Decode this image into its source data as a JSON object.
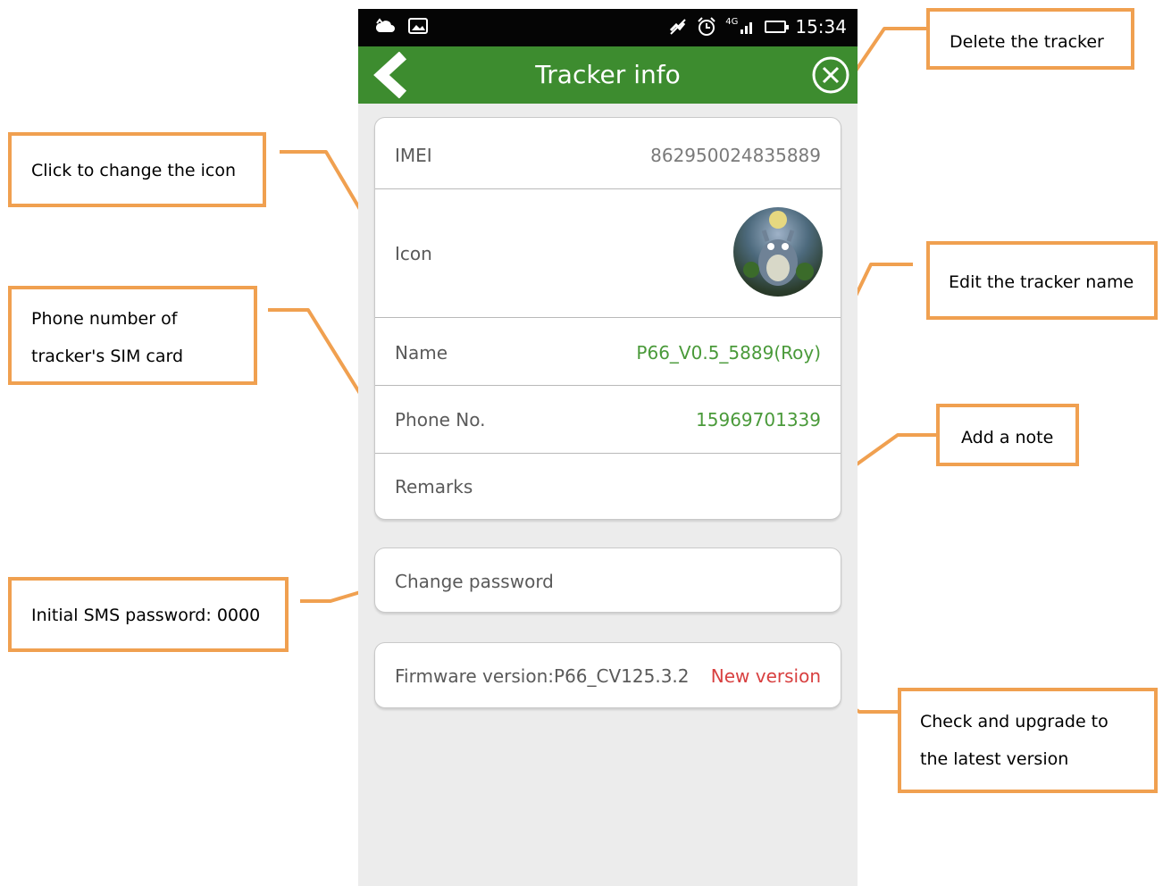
{
  "status_bar": {
    "icons_left": [
      "cloud-icon",
      "image-icon"
    ],
    "icons_right": [
      "mute-icon",
      "alarm-icon",
      "signal-icon",
      "battery-icon"
    ],
    "network": "4G",
    "time": "15:34"
  },
  "app_bar": {
    "title": "Tracker info",
    "back_icon": "chevron-left-icon",
    "delete_icon": "close-circle-icon"
  },
  "info": {
    "imei_label": "IMEI",
    "imei_value": "862950024835889",
    "icon_label": "Icon",
    "name_label": "Name",
    "name_value": "P66_V0.5_5889(Roy)",
    "phone_label": "Phone No.",
    "phone_value": "15969701339",
    "remarks_label": "Remarks"
  },
  "password": {
    "label": "Change password"
  },
  "firmware": {
    "label": "Firmware version:P66_CV125.3.2",
    "new_version": "New version"
  },
  "callouts": {
    "delete": "Delete the tracker",
    "change_icon": "Click to change the icon",
    "edit_name": "Edit the tracker name",
    "phone_line1": "Phone number of",
    "phone_line2": "tracker's SIM card",
    "add_note": "Add a note",
    "sms_password": "Initial SMS password: 0000",
    "upgrade_line1": "Check and upgrade to",
    "upgrade_line2": "the latest version"
  },
  "colors": {
    "app_bar": "#3d8c2f",
    "value_green": "#4a9a3a",
    "new_version_red": "#d84040",
    "callout_border": "#f0a050"
  }
}
